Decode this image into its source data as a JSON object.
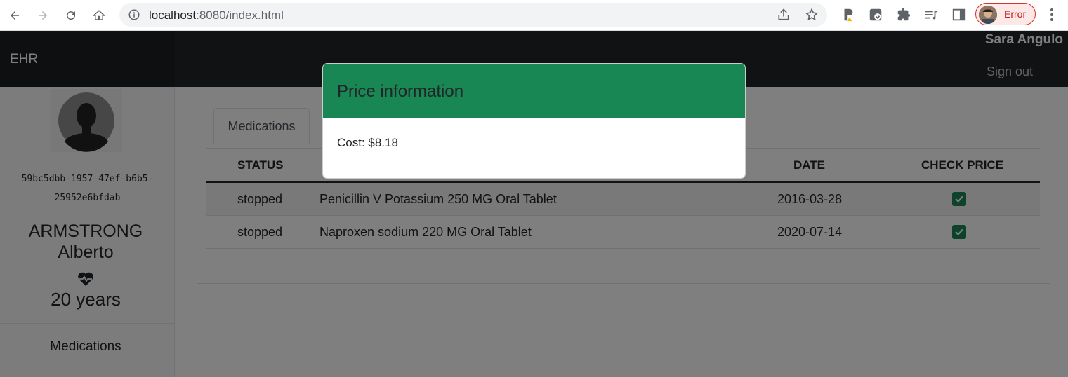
{
  "browser": {
    "url_host": "localhost",
    "url_rest": ":8080/index.html",
    "profile_status": "Error"
  },
  "app": {
    "brand": "EHR",
    "user_name": "Sara Angulo",
    "sign_out": "Sign out"
  },
  "patient": {
    "id_line1": "59bc5dbb-1957-47ef-b6b5-",
    "id_line2": "25952e6bfdab",
    "last_name": "ARMSTRONG",
    "first_name": "Alberto",
    "age": "20 years"
  },
  "sidebar": {
    "nav_label": "Medications"
  },
  "tabs": [
    {
      "label": "Medications"
    }
  ],
  "table": {
    "headers": {
      "status": "STATUS",
      "date": "DATE",
      "check_price": "CHECK PRICE"
    },
    "rows": [
      {
        "status": "stopped",
        "description": "Penicillin V Potassium 250 MG Oral Tablet",
        "date": "2016-03-28",
        "checked": true
      },
      {
        "status": "stopped",
        "description": "Naproxen sodium 220 MG Oral Tablet",
        "date": "2020-07-14",
        "checked": true
      }
    ]
  },
  "modal": {
    "title": "Price information",
    "body": "Cost: $8.18"
  },
  "colors": {
    "header_bg": "#212529",
    "accent": "#198754",
    "profile_error": "#c5221f"
  },
  "icons": [
    "back-icon",
    "forward-icon",
    "reload-icon",
    "home-icon",
    "info-icon",
    "share-icon",
    "star-icon",
    "extension-icon",
    "puzzle-icon",
    "reading-list-icon",
    "side-panel-icon",
    "menu-icon",
    "heart-pulse-icon",
    "check-icon"
  ]
}
